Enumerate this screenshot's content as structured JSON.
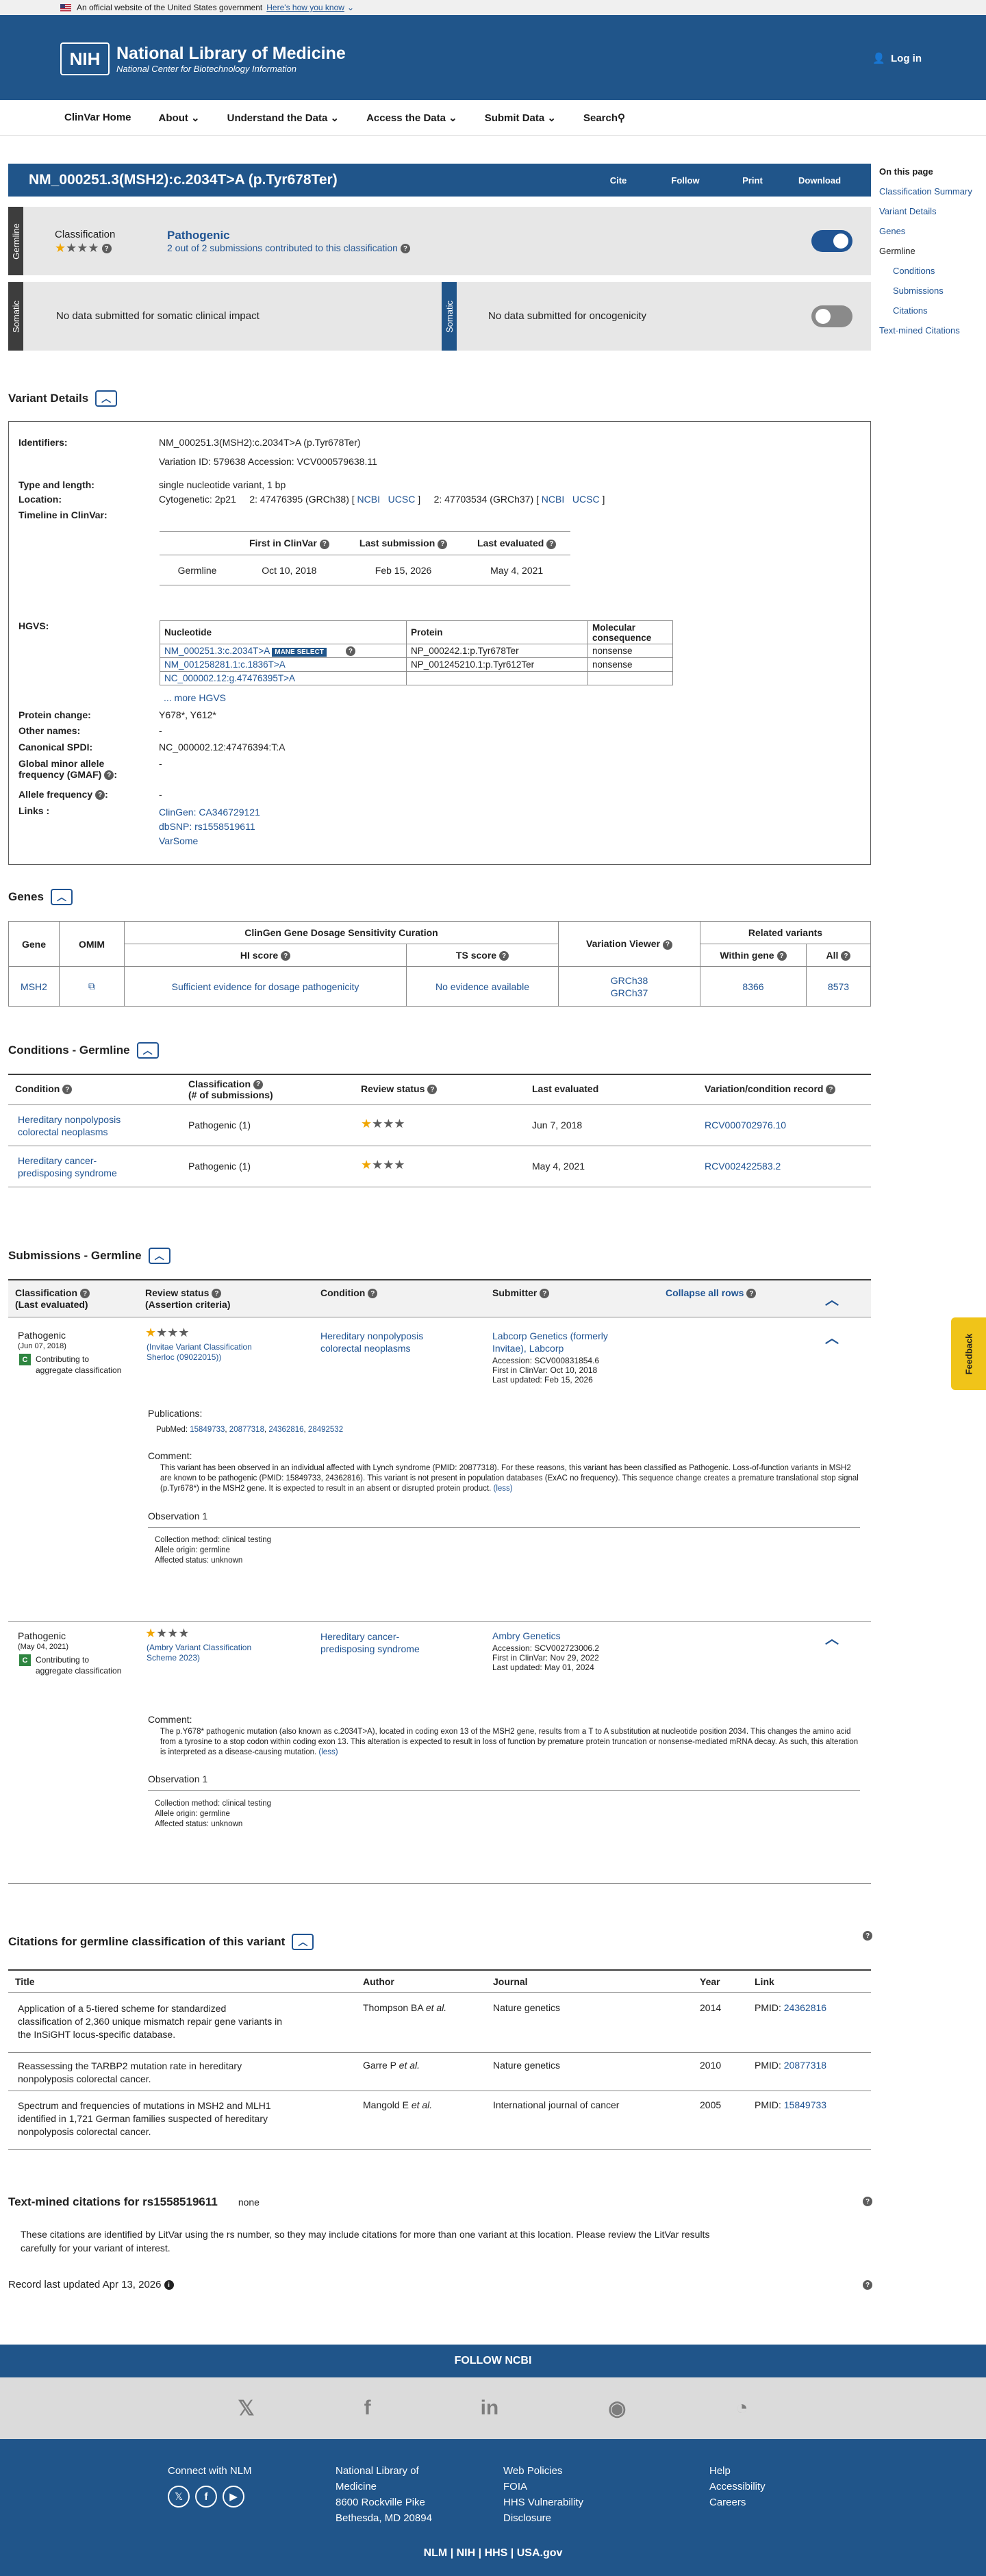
{
  "gov": {
    "official": "An official website of the United States government",
    "how": "Here's how you know"
  },
  "header": {
    "logo": "NIH",
    "title": "National Library of Medicine",
    "subtitle": "National Center for Biotechnology Information",
    "login": "Log in"
  },
  "nav": [
    "ClinVar Home",
    "About",
    "Understand the Data",
    "Access the Data",
    "Submit Data",
    "Search"
  ],
  "title": {
    "text": "NM_000251.3(MSH2):c.2034T>A (p.Tyr678Ter)",
    "buttons": [
      "Cite",
      "Follow",
      "Print",
      "Download"
    ]
  },
  "germline": {
    "label": "Germline",
    "cls_label": "Classification",
    "cls": "Pathogenic",
    "subs": "2 out of 2 submissions contributed to this classification"
  },
  "somatic": {
    "label": "Somatic",
    "msg1": "No data submitted for somatic clinical impact",
    "msg2": "No data submitted for oncogenicity"
  },
  "toc": {
    "head": "On this page",
    "items": [
      "Classification Summary",
      "Variant Details",
      "Genes",
      "Germline",
      "Conditions",
      "Submissions",
      "Citations",
      "Text-mined Citations"
    ]
  },
  "variant": {
    "head": "Variant Details",
    "identifiers": "NM_000251.3(MSH2):c.2034T>A (p.Tyr678Ter)",
    "vid": "Variation ID: 579638",
    "acc": "Accession: VCV000579638.11",
    "type": "single nucleotide variant, 1 bp",
    "cyto": "Cytogenetic: 2p21",
    "loc38": "2: 47476395 (GRCh38)",
    "loc37": "2: 47703534 (GRCh37)",
    "ncbi": "NCBI",
    "ucsc": "UCSC",
    "timeline": {
      "h": [
        "First in ClinVar",
        "Last submission",
        "Last evaluated"
      ],
      "row": [
        "Germline",
        "Oct 10, 2018",
        "Feb 15, 2026",
        "May 4, 2021"
      ]
    },
    "hgvs_h": [
      "Nucleotide",
      "Protein",
      "Molecular consequence"
    ],
    "hgvs": [
      [
        "NM_000251.3:c.2034T>A",
        "NP_000242.1:p.Tyr678Ter",
        "nonsense"
      ],
      [
        "NM_001258281.1:c.1836T>A",
        "NP_001245210.1:p.Tyr612Ter",
        "nonsense"
      ],
      [
        "NC_000002.12:g.47476395T>A",
        "",
        ""
      ]
    ],
    "mane": "MANE SELECT",
    "more": "... more HGVS",
    "protein": "Y678*, Y612*",
    "other": "-",
    "spdi": "NC_000002.12:47476394:T:A",
    "gmaf": "-",
    "af": "-",
    "links": [
      "ClinGen: CA346729121",
      "dbSNP: rs1558519611",
      "VarSome"
    ],
    "labels": {
      "identifiers": "Identifiers:",
      "type": "Type and length:",
      "location": "Location:",
      "timeline": "Timeline in ClinVar:",
      "hgvs": "HGVS:",
      "protein": "Protein change:",
      "other": "Other names:",
      "spdi": "Canonical SPDI:",
      "gmaf1": "Global minor allele",
      "gmaf2": "frequency (GMAF)",
      "af": "Allele frequency",
      "links": "Links :"
    }
  },
  "genes": {
    "head": "Genes",
    "h_gene": "Gene",
    "h_omim": "OMIM",
    "h_cg": "ClinGen Gene Dosage Sensitivity Curation",
    "h_hi": "HI score",
    "h_ts": "TS score",
    "h_vv": "Variation Viewer",
    "h_rel": "Related variants",
    "h_within": "Within gene",
    "h_all": "All",
    "gene": "MSH2",
    "hi": "Sufficient evidence for dosage pathogenicity",
    "ts": "No evidence available",
    "vv": [
      "GRCh38",
      "GRCh37"
    ],
    "within": "8366",
    "all": "8573"
  },
  "conditions": {
    "head": "Conditions - Germline",
    "h": [
      "Condition",
      "Classification",
      "(# of submissions)",
      "Review status",
      "Last evaluated",
      "Variation/condition record"
    ],
    "rows": [
      {
        "c1": "Hereditary nonpolyposis",
        "c2": "colorectal neoplasms",
        "cls": "Pathogenic (1)",
        "date": "Jun 7, 2018",
        "rcv": "RCV000702976.10"
      },
      {
        "c1": "Hereditary cancer-",
        "c2": "predisposing syndrome",
        "cls": "Pathogenic (1)",
        "date": "May 4, 2021",
        "rcv": "RCV002422583.2"
      }
    ]
  },
  "subs": {
    "head": "Submissions - Germline",
    "h": [
      "Classification",
      "(Last evaluated)",
      "Review status",
      "(Assertion criteria)",
      "Condition",
      "Submitter",
      "Collapse all rows"
    ],
    "contrib1": "Contributing to",
    "contrib2": "aggregate classification",
    "pub_label": "Publications:",
    "pubmed": "PubMed:",
    "comment": "Comment:",
    "obs": "Observation 1",
    "less": "(less)",
    "s1": {
      "cls": "Pathogenic",
      "date": "(Jun 07, 2018)",
      "crit1": "(Invitae Variant Classification",
      "crit2": "Sherloc (09022015))",
      "cond1": "Hereditary nonpolyposis",
      "cond2": "colorectal neoplasms",
      "sub1": "Labcorp Genetics (formerly",
      "sub2": "Invitae), Labcorp",
      "acc": "Accession: SCV000831854.6",
      "first": "First in ClinVar: Oct 10, 2018",
      "upd": "Last updated: Feb 15, 2026",
      "pmids": [
        "15849733",
        "20877318",
        "24362816",
        "28492532"
      ],
      "text": "This variant has been observed in an individual affected with Lynch syndrome (PMID: 20877318). For these reasons, this variant has been classified as Pathogenic. Loss-of-function variants in MSH2 are known to be pathogenic (PMID: 15849733, 24362816). This variant is not present in population databases (ExAC no frequency). This sequence change creates a premature translational stop signal (p.Tyr678*) in the MSH2 gene. It is expected to result in an absent or disrupted protein product.",
      "obs": [
        "Collection method: clinical testing",
        "Allele origin: germline",
        "Affected status: unknown"
      ]
    },
    "s2": {
      "cls": "Pathogenic",
      "date": "(May 04, 2021)",
      "crit1": "(Ambry Variant Classification",
      "crit2": "Scheme 2023)",
      "cond1": "Hereditary cancer-",
      "cond2": "predisposing syndrome",
      "sub1": "Ambry Genetics",
      "acc": "Accession: SCV002723006.2",
      "first": "First in ClinVar: Nov 29, 2022",
      "upd": "Last updated: May 01, 2024",
      "text": "The p.Y678* pathogenic mutation (also known as c.2034T>A), located in coding exon 13 of the MSH2 gene, results from a T to A substitution at nucleotide position 2034. This changes the amino acid from a tyrosine to a stop codon within coding exon 13. This alteration is expected to result in loss of function by premature protein truncation or nonsense-mediated mRNA decay. As such, this alteration is interpreted as a disease-causing mutation.",
      "obs": [
        "Collection method: clinical testing",
        "Allele origin: germline",
        "Affected status: unknown"
      ]
    }
  },
  "citations": {
    "head": "Citations for germline classification of this variant",
    "h": [
      "Title",
      "Author",
      "Journal",
      "Year",
      "Link"
    ],
    "rows": [
      {
        "t1": "Application of a 5-tiered scheme for standardized",
        "t2": "classification of 2,360 unique mismatch repair gene variants in",
        "t3": "the InSiGHT locus-specific database.",
        "a": "Thompson BA",
        "j": "Nature genetics",
        "y": "2014",
        "p": "24362816"
      },
      {
        "t1": "Reassessing the TARBP2 mutation rate in hereditary",
        "t2": "nonpolyposis colorectal cancer.",
        "t3": "",
        "a": "Garre P",
        "j": "Nature genetics",
        "y": "2010",
        "p": "20877318"
      },
      {
        "t1": "Spectrum and frequencies of mutations in MSH2 and MLH1",
        "t2": "identified in 1,721 German families suspected of hereditary",
        "t3": "nonpolyposis colorectal cancer.",
        "a": "Mangold E",
        "j": "International journal of cancer",
        "y": "2005",
        "p": "15849733"
      }
    ],
    "etal": "et al.",
    "pmid": "PMID:"
  },
  "textmined": {
    "head": "Text-mined citations for rs1558519611",
    "none": "none",
    "text1": "These citations are identified by LitVar using the rs number, so they may include citations for more than one variant at this location. Please review the LitVar results",
    "text2": "carefully for your variant of interest."
  },
  "record": "Record last updated Apr 13, 2026",
  "feedback": "Feedback",
  "follow": "FOLLOW NCBI",
  "footer": {
    "c1": [
      "Connect with NLM"
    ],
    "c2": [
      "National Library of",
      "Medicine",
      "8600 Rockville Pike",
      "Bethesda, MD 20894"
    ],
    "c3": [
      "Web Policies",
      "FOIA",
      "HHS Vulnerability",
      "Disclosure"
    ],
    "c4": [
      "Help",
      "Accessibility",
      "Careers"
    ],
    "bottom": [
      "NLM",
      "NIH",
      "HHS",
      "USA.gov"
    ]
  }
}
